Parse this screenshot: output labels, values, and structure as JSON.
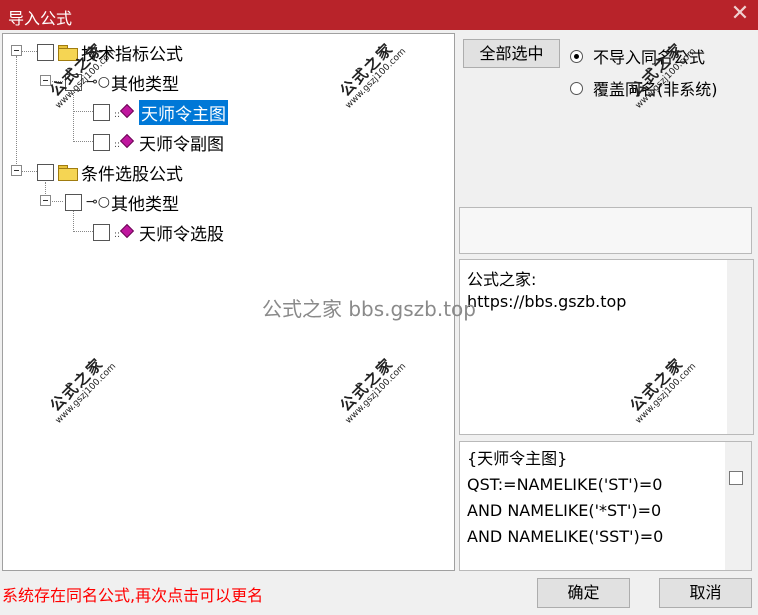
{
  "window": {
    "title": "导入公式",
    "close_glyph": "✕"
  },
  "tree": {
    "nodes": [
      {
        "label": "技术指标公式",
        "icon": "folder-icon"
      },
      {
        "label": "其他类型",
        "icon": "key-icon"
      },
      {
        "label": "天师令主图",
        "icon": "formula-icon",
        "selected": true
      },
      {
        "label": "天师令副图",
        "icon": "formula-icon"
      },
      {
        "label": "条件选股公式",
        "icon": "folder-icon"
      },
      {
        "label": "其他类型",
        "icon": "key-icon"
      },
      {
        "label": "天师令选股",
        "icon": "formula-icon"
      }
    ]
  },
  "options": {
    "select_all_label": "全部选中",
    "radio_no_import": "不导入同名公式",
    "radio_overwrite": "覆盖同名(非系统)"
  },
  "info": {
    "line1": "公式之家:",
    "line2": "https://bbs.gszb.top"
  },
  "code": {
    "lines": [
      "{天师令主图}",
      "QST:=NAMELIKE('ST')=0",
      "AND NAMELIKE('*ST')=0",
      "AND NAMELIKE('SST')=0"
    ]
  },
  "status_message": "系统存在同名公式,再次点击可以更名",
  "buttons": {
    "ok_label": "确定",
    "cancel_label": "取消"
  },
  "watermark": {
    "center": "公式之家 bbs.gszb.top",
    "stamp_text": "公式之家",
    "stamp_url": "www.gszj100.com"
  },
  "colors": {
    "titlebar": "#b8232a",
    "selection": "#0078d7",
    "status": "#ff0000"
  }
}
